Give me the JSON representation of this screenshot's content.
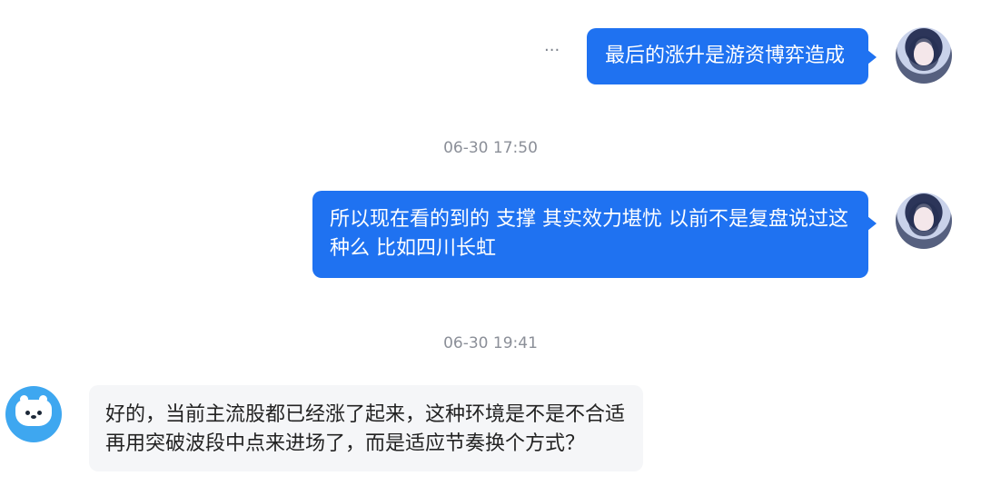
{
  "messages": [
    {
      "side": "out",
      "text": "最后的涨升是游资博弈造成",
      "action": "···"
    },
    {
      "side": "out",
      "text": "所以现在看的到的 支撑 其实效力堪忧 以前不是复盘说过这种么 比如四川长虹"
    },
    {
      "side": "in",
      "text": "好的，当前主流股都已经涨了起来，这种环境是不是不合适再用突破波段中点来进场了，而是适应节奏换个方式？"
    }
  ],
  "timestamps": {
    "first": "06-30 17:50",
    "second": "06-30 19:41"
  },
  "colors": {
    "outgoing_bubble": "#1f72f1",
    "incoming_bubble": "#f5f6f8",
    "timestamp": "#8b8f98"
  },
  "icons": {
    "user_avatar": "user-avatar-icon",
    "bot_avatar": "bot-avatar-icon",
    "more": "more-options-icon"
  }
}
